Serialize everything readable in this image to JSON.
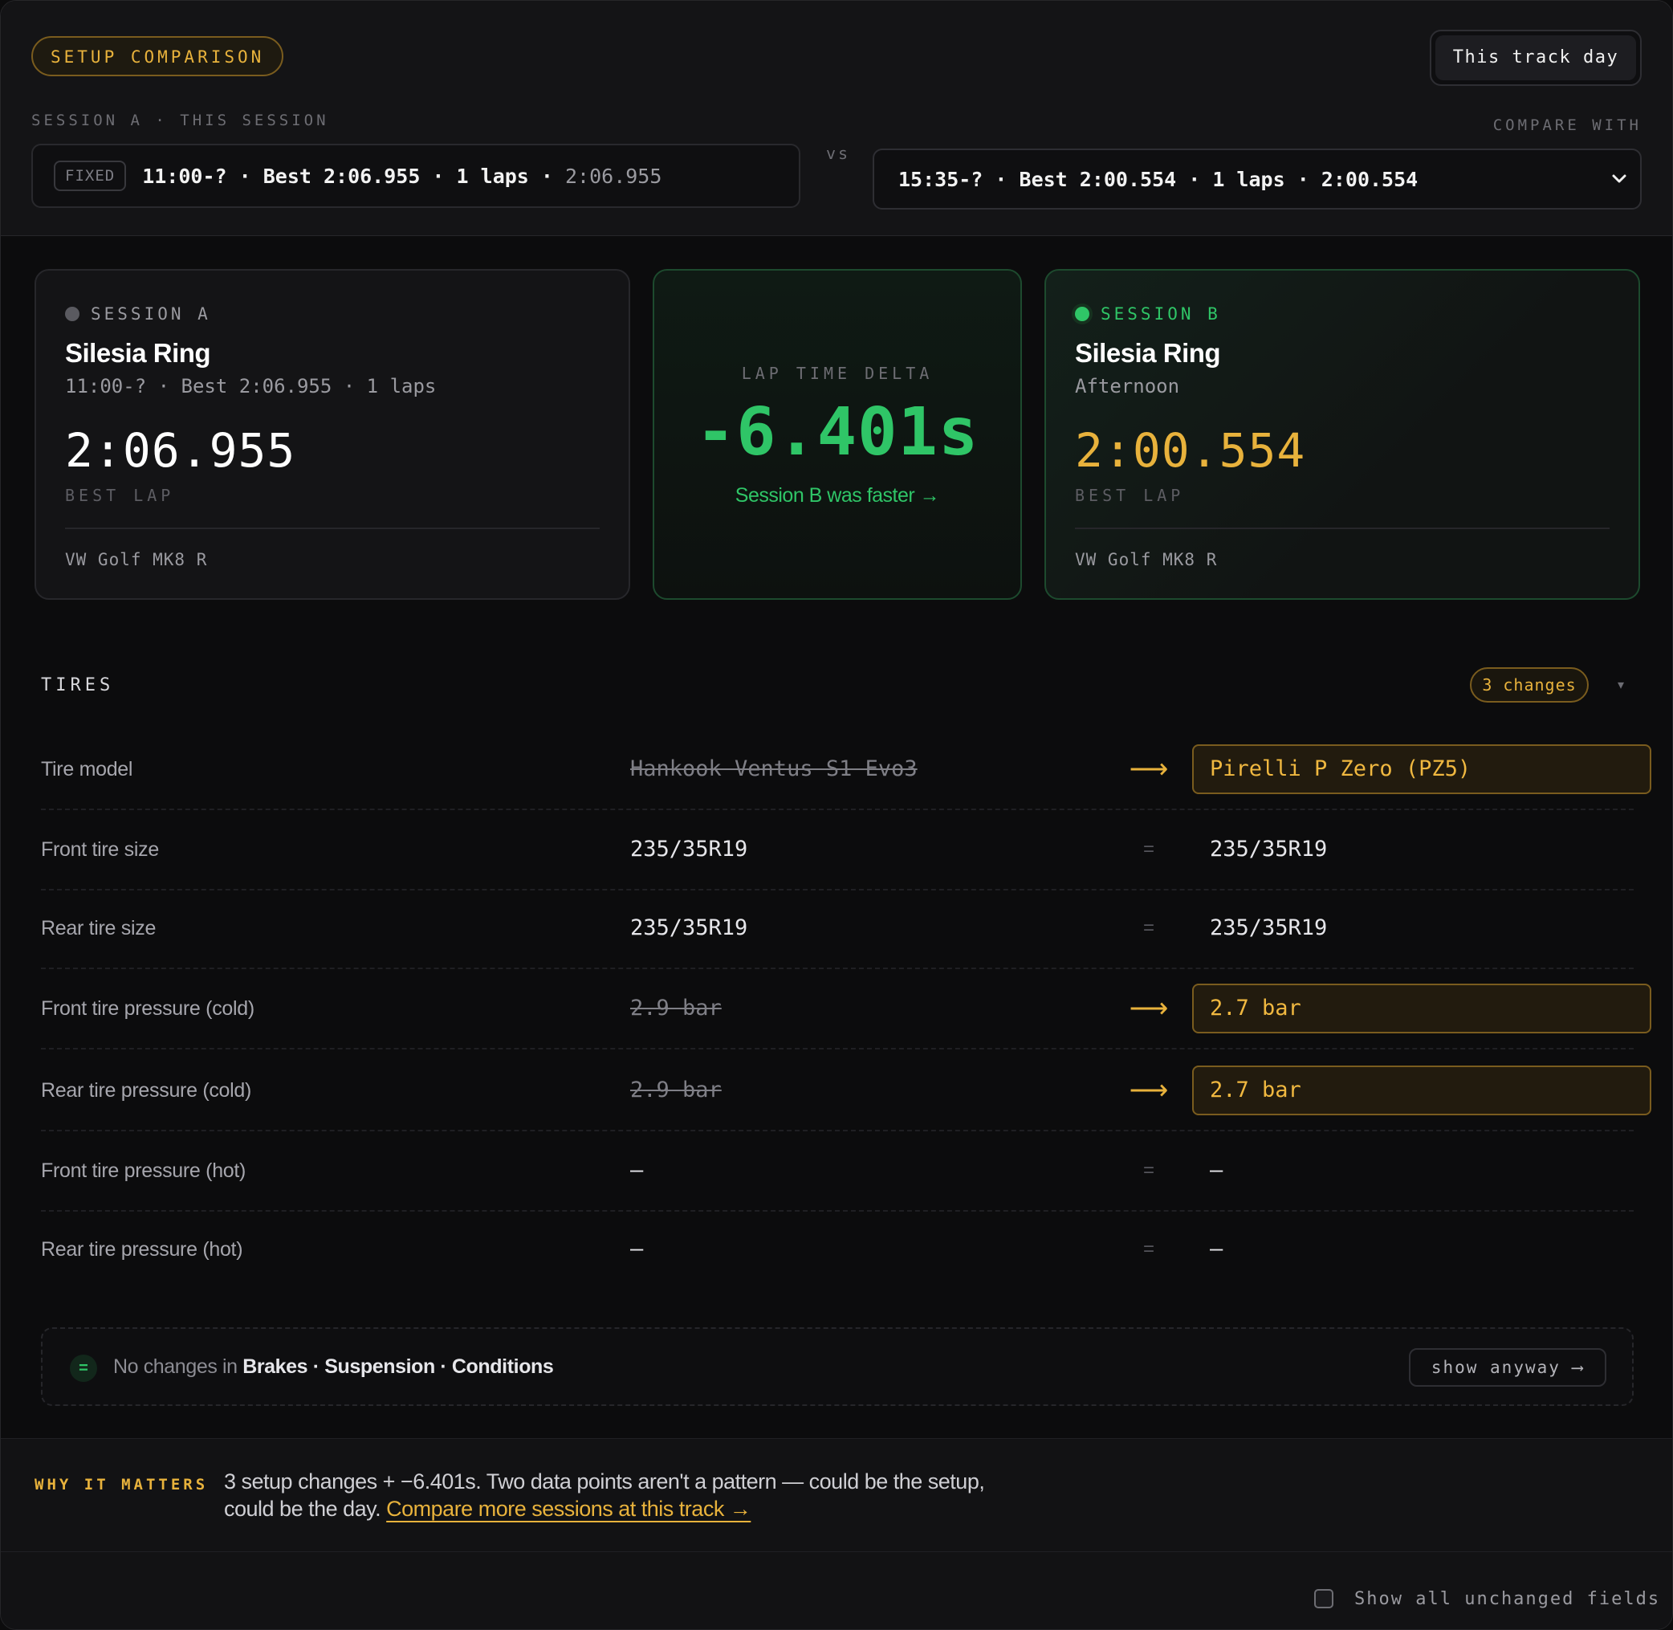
{
  "header": {
    "badge": "SETUP COMPARISON",
    "scope_button": "This track day",
    "session_a_label": "SESSION A · THIS SESSION",
    "compare_label": "COMPARE WITH",
    "fixed_tag": "FIXED",
    "session_a_summary": "11:00-? · Best 2:06.955 · 1 laps · ",
    "session_a_time": "2:06.955",
    "vs": "vs",
    "session_b_selected": "15:35-? · Best 2:00.554 · 1 laps · 2:00.554"
  },
  "session_a": {
    "label": "SESSION A",
    "track": "Silesia Ring",
    "sub": "11:00-? · Best 2:06.955 · 1 laps",
    "best": "2:06.955",
    "best_label": "BEST LAP",
    "car": "VW Golf MK8 R",
    "dot_color": "#5a5a60"
  },
  "delta": {
    "label": "LAP TIME DELTA",
    "value": "-6.401s",
    "note": "Session B  was faster →",
    "color": "#2fc567"
  },
  "session_b": {
    "label": "SESSION B",
    "track": "Silesia Ring",
    "sub": "Afternoon",
    "best": "2:00.554",
    "best_label": "BEST LAP",
    "car": "VW Golf MK8 R",
    "dot_color": "#2fc567",
    "best_color": "#e8b23c"
  },
  "tires": {
    "title": "TIRES",
    "changes": "3 changes",
    "caret": "▾",
    "rows": [
      {
        "name": "Tire model",
        "a": "Hankook Ventus S1 Evo3",
        "sym": "⟶",
        "b": "Pirelli P Zero (PZ5)"
      },
      {
        "name": "Front tire size",
        "a": "235/35R19",
        "sym": "=",
        "b": "235/35R19"
      },
      {
        "name": "Rear tire size",
        "a": "235/35R19",
        "sym": "=",
        "b": "235/35R19"
      },
      {
        "name": "Front tire pressure (cold)",
        "a": "2.9 bar",
        "sym": "⟶",
        "b": "2.7 bar"
      },
      {
        "name": "Rear tire pressure (cold)",
        "a": "2.9 bar",
        "sym": "⟶",
        "b": "2.7 bar"
      },
      {
        "name": "Front tire pressure (hot)",
        "a": "—",
        "sym": "=",
        "b": "—"
      },
      {
        "name": "Rear tire pressure (hot)",
        "a": "—",
        "sym": "=",
        "b": "—"
      }
    ]
  },
  "no_changes": {
    "badge": "=",
    "prefix": "No changes in ",
    "categories": "Brakes · Suspension · Conditions",
    "button": "show anyway ⟶"
  },
  "why": {
    "label": "WHY IT MATTERS",
    "text": "3 setup changes + −6.401s. Two data points aren't a pattern — could be the setup, could be the day. ",
    "link": "Compare more sessions at this track →"
  },
  "footer": {
    "checkbox_label": "Show all unchanged fields"
  },
  "colors": {
    "accent": "#e8b23c",
    "positive": "#2fc567",
    "background": "#0c0c0d"
  }
}
